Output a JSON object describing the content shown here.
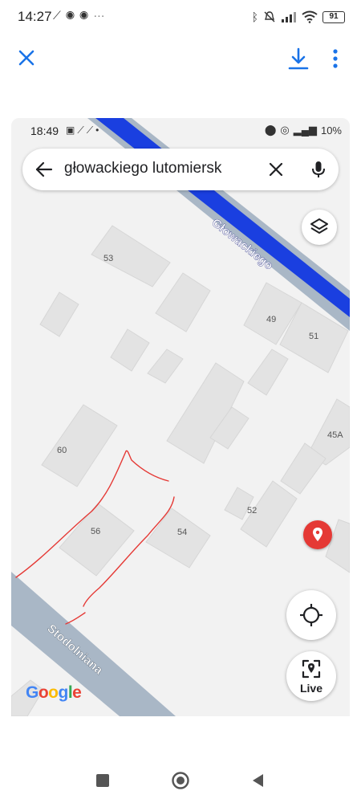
{
  "status_bar": {
    "time": "14:27",
    "left_icons": [
      "notification-icon",
      "chrome-icon",
      "chrome-icon",
      "more-notifications-icon"
    ],
    "right_icons": [
      "bluetooth-icon",
      "silent-icon",
      "signal-icon",
      "wifi-icon"
    ],
    "battery": "91"
  },
  "viewer_toolbar": {
    "close_icon": "close-icon",
    "download_icon": "download-icon",
    "more_icon": "more-vert-icon",
    "accent": "#1a73e8"
  },
  "screenshot": {
    "status": {
      "time": "18:49",
      "right_text": "10%"
    },
    "search": {
      "query": "głowackiego lutomiersk"
    },
    "streets": {
      "glowackiego": "Głowackiego",
      "stodolniana": "Stodolniana"
    },
    "buildings": {
      "b53": "53",
      "b49": "49",
      "b51": "51",
      "b45a": "45A",
      "b60": "60",
      "b52": "52",
      "b56": "56",
      "b54": "54"
    },
    "live_label": "Live",
    "google_logo": "Google",
    "colors": {
      "route": "#1a3fe0",
      "street": "#a9b7c6",
      "building": "#e3e3e3",
      "pin": "#e53935",
      "annotation": "#e53935"
    }
  },
  "nav_bar": {
    "icons": [
      "recents-square-icon",
      "home-circle-icon",
      "back-triangle-icon"
    ]
  }
}
